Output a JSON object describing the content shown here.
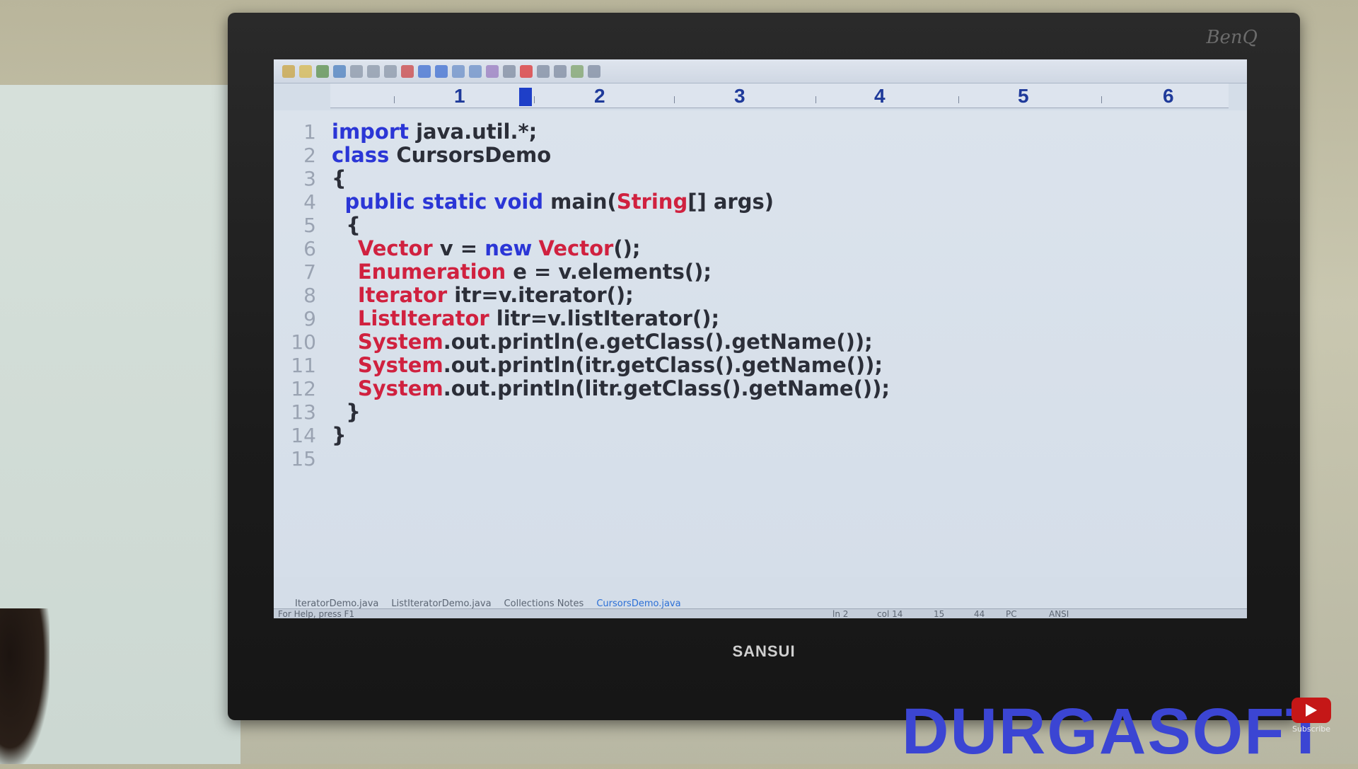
{
  "editor": {
    "ruler_numbers": [
      "1",
      "2",
      "3",
      "4",
      "5",
      "6"
    ],
    "lines": [
      {
        "num": "1",
        "tokens": [
          {
            "t": "import",
            "c": "kw"
          },
          {
            "t": " java.util.*;",
            "c": "id"
          }
        ]
      },
      {
        "num": "2",
        "tokens": [
          {
            "t": "class",
            "c": "kw"
          },
          {
            "t": " CursorsDemo",
            "c": "id"
          }
        ]
      },
      {
        "num": "3",
        "tokens": [
          {
            "t": "{",
            "c": "id"
          }
        ]
      },
      {
        "num": "4",
        "tokens": [
          {
            "t": "  ",
            "c": ""
          },
          {
            "t": "public static void",
            "c": "kw"
          },
          {
            "t": " main(",
            "c": "id"
          },
          {
            "t": "String",
            "c": "ty"
          },
          {
            "t": "[] args)",
            "c": "id"
          }
        ]
      },
      {
        "num": "5",
        "tokens": [
          {
            "t": "  {",
            "c": "id"
          }
        ]
      },
      {
        "num": "6",
        "tokens": [
          {
            "t": "    ",
            "c": ""
          },
          {
            "t": "Vector",
            "c": "ty"
          },
          {
            "t": " v = ",
            "c": "id"
          },
          {
            "t": "new",
            "c": "kw"
          },
          {
            "t": " ",
            "c": ""
          },
          {
            "t": "Vector",
            "c": "ty"
          },
          {
            "t": "();",
            "c": "id"
          }
        ]
      },
      {
        "num": "7",
        "tokens": [
          {
            "t": "    ",
            "c": ""
          },
          {
            "t": "Enumeration",
            "c": "ty"
          },
          {
            "t": " e = v.elements();",
            "c": "id"
          }
        ]
      },
      {
        "num": "8",
        "tokens": [
          {
            "t": "    ",
            "c": ""
          },
          {
            "t": "Iterator",
            "c": "ty"
          },
          {
            "t": " itr=v.iterator();",
            "c": "id"
          }
        ]
      },
      {
        "num": "9",
        "tokens": [
          {
            "t": "    ",
            "c": ""
          },
          {
            "t": "ListIterator",
            "c": "ty"
          },
          {
            "t": " litr=v.listIterator();",
            "c": "id"
          }
        ]
      },
      {
        "num": "10",
        "tokens": [
          {
            "t": "    ",
            "c": ""
          },
          {
            "t": "System",
            "c": "ty"
          },
          {
            "t": ".out.println(e.getClass().getName());",
            "c": "id"
          }
        ]
      },
      {
        "num": "11",
        "tokens": [
          {
            "t": "    ",
            "c": ""
          },
          {
            "t": "System",
            "c": "ty"
          },
          {
            "t": ".out.println(itr.getClass().getName());",
            "c": "id"
          }
        ]
      },
      {
        "num": "12",
        "tokens": [
          {
            "t": "    ",
            "c": ""
          },
          {
            "t": "System",
            "c": "ty"
          },
          {
            "t": ".out.println(litr.getClass().getName());",
            "c": "id"
          }
        ]
      },
      {
        "num": "13",
        "tokens": [
          {
            "t": "  }",
            "c": "id"
          }
        ]
      },
      {
        "num": "14",
        "tokens": [
          {
            "t": "}",
            "c": "id"
          }
        ]
      },
      {
        "num": "15",
        "tokens": []
      }
    ]
  },
  "tabs": [
    {
      "label": "IteratorDemo.java",
      "active": false
    },
    {
      "label": "ListIteratorDemo.java",
      "active": false
    },
    {
      "label": "Collections Notes",
      "active": false
    },
    {
      "label": "CursorsDemo.java",
      "active": true
    }
  ],
  "status": {
    "help": "For Help, press F1",
    "line": "ln 2",
    "col": "col 14",
    "lines_count": "15",
    "chars": "44",
    "mode": "PC",
    "encoding": "ANSI"
  },
  "monitor": {
    "brand": "SANSUI",
    "logo": "BenQ"
  },
  "overlay": {
    "watermark": "DURGASOFT",
    "subscribe_label": "Subscribe"
  },
  "colors": {
    "keyword": "#2b36d6",
    "type": "#d0213f",
    "watermark": "#3b45d3"
  }
}
